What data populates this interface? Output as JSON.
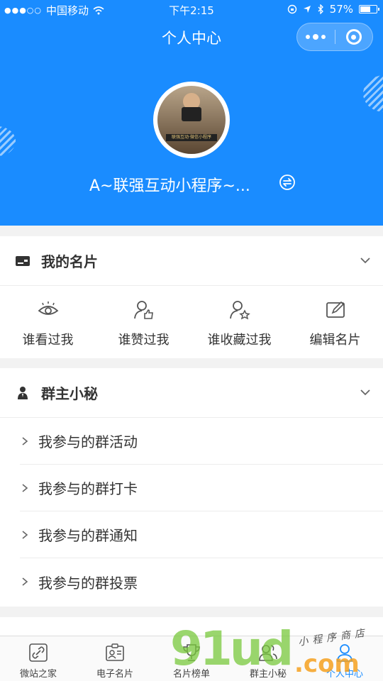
{
  "status_bar": {
    "carrier": "中国移动",
    "time": "下午2:15",
    "battery": "57%"
  },
  "nav": {
    "title": "个人中心"
  },
  "profile": {
    "name": "A~联强互动小程序~...",
    "avatar_badge": "联强互动·微信小程序"
  },
  "sections": {
    "card": {
      "title": "我的名片",
      "actions": [
        {
          "label": "谁看过我",
          "icon": "eye-icon"
        },
        {
          "label": "谁赞过我",
          "icon": "user-thumbs-up-icon"
        },
        {
          "label": "谁收藏过我",
          "icon": "user-star-icon"
        },
        {
          "label": "编辑名片",
          "icon": "edit-icon"
        }
      ]
    },
    "group": {
      "title": "群主小秘",
      "items": [
        "我参与的群活动",
        "我参与的群打卡",
        "我参与的群通知",
        "我参与的群投票"
      ]
    }
  },
  "tabbar": {
    "items": [
      {
        "label": "微站之家",
        "icon": "link-icon",
        "active": false
      },
      {
        "label": "电子名片",
        "icon": "id-card-icon",
        "active": false
      },
      {
        "label": "名片榜单",
        "icon": "trophy-icon",
        "active": false
      },
      {
        "label": "群主小秘",
        "icon": "group-icon",
        "active": false
      },
      {
        "label": "个人中心",
        "icon": "person-icon",
        "active": true
      }
    ]
  },
  "watermark": {
    "logo": "91ud",
    "domain": ".com",
    "tagline": "小程序商店"
  },
  "colors": {
    "primary": "#1a8cff",
    "background": "#f2f2f2"
  }
}
